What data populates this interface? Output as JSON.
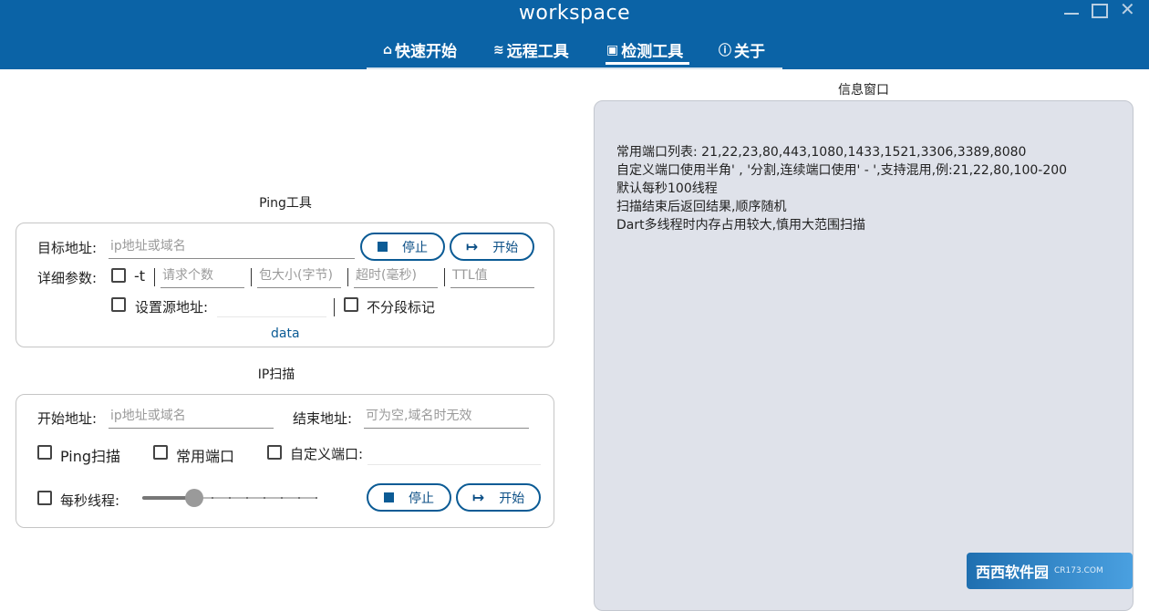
{
  "window": {
    "title": "workspace"
  },
  "tabs": [
    {
      "icon": "home-icon",
      "glyph": "⌂",
      "label": "快速开始"
    },
    {
      "icon": "wifi-icon",
      "glyph": "≋",
      "label": "远程工具"
    },
    {
      "icon": "terminal-icon",
      "glyph": "▣",
      "label": "检测工具",
      "active": true
    },
    {
      "icon": "info-icon",
      "glyph": "ⓘ",
      "label": "关于"
    }
  ],
  "ping": {
    "title": "Ping工具",
    "target_label": "目标地址:",
    "target_placeholder": "ip地址或域名",
    "stop_label": "停止",
    "start_label": "开始",
    "params_label": "详细参数:",
    "t_label": "-t",
    "count_placeholder": "请求个数",
    "size_placeholder": "包大小(字节)",
    "timeout_placeholder": "超时(毫秒)",
    "ttl_placeholder": "TTL值",
    "source_label": "设置源地址:",
    "nofrag_label": "不分段标记",
    "data_link": "data"
  },
  "ipscan": {
    "title": "IP扫描",
    "start_addr_label": "开始地址:",
    "start_addr_placeholder": "ip地址或域名",
    "end_addr_label": "结束地址:",
    "end_addr_placeholder": "可为空,域名时无效",
    "ping_scan_label": "Ping扫描",
    "common_ports_label": "常用端口",
    "custom_ports_label": "自定义端口:",
    "threads_label": "每秒线程:",
    "threads_level": 0.3,
    "stop_label": "停止",
    "start_label": "开始"
  },
  "info": {
    "title": "信息窗口",
    "lines": [
      "常用端口列表: 21,22,23,80,443,1080,1433,1521,3306,3389,8080",
      "自定义端口使用半角' , '分割,连续端口使用' - ',支持混用,例:21,22,80,100-200",
      "默认每秒100线程",
      "扫描结束后返回结果,顺序随机",
      "Dart多线程时内存占用较大,慎用大范围扫描"
    ]
  },
  "watermark": {
    "text": "西西软件园",
    "sub": "CR173.COM"
  }
}
